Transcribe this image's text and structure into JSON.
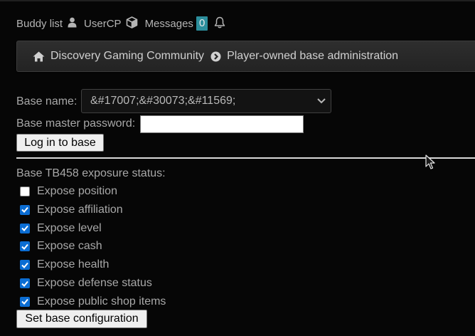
{
  "userbar": {
    "buddy_list": "Buddy list",
    "usercp": "UserCP",
    "messages": "Messages",
    "messages_count": "0",
    "icons": [
      "user-icon",
      "cube-icon",
      "bell-icon"
    ]
  },
  "breadcrumb": {
    "home": "Discovery Gaming Community",
    "current": "Player-owned base administration"
  },
  "form": {
    "base_name_label": "Base name:",
    "base_name_value": "&#17007;&#30073;&#11569;",
    "password_label": "Base master password:",
    "password_value": "",
    "login_button": "Log in to base",
    "exposure_label": "Base TB458 exposure status:",
    "options": [
      {
        "label": "Expose position",
        "checked": false
      },
      {
        "label": "Expose affiliation",
        "checked": true
      },
      {
        "label": "Expose level",
        "checked": true
      },
      {
        "label": "Expose cash",
        "checked": true
      },
      {
        "label": "Expose health",
        "checked": true
      },
      {
        "label": "Expose defense status",
        "checked": true
      },
      {
        "label": "Expose public shop items",
        "checked": true
      }
    ],
    "submit_button": "Set base configuration"
  },
  "colors": {
    "background": "#060606",
    "badge": "#2c8e9c",
    "checkbox_on": "#0b6dd3"
  }
}
